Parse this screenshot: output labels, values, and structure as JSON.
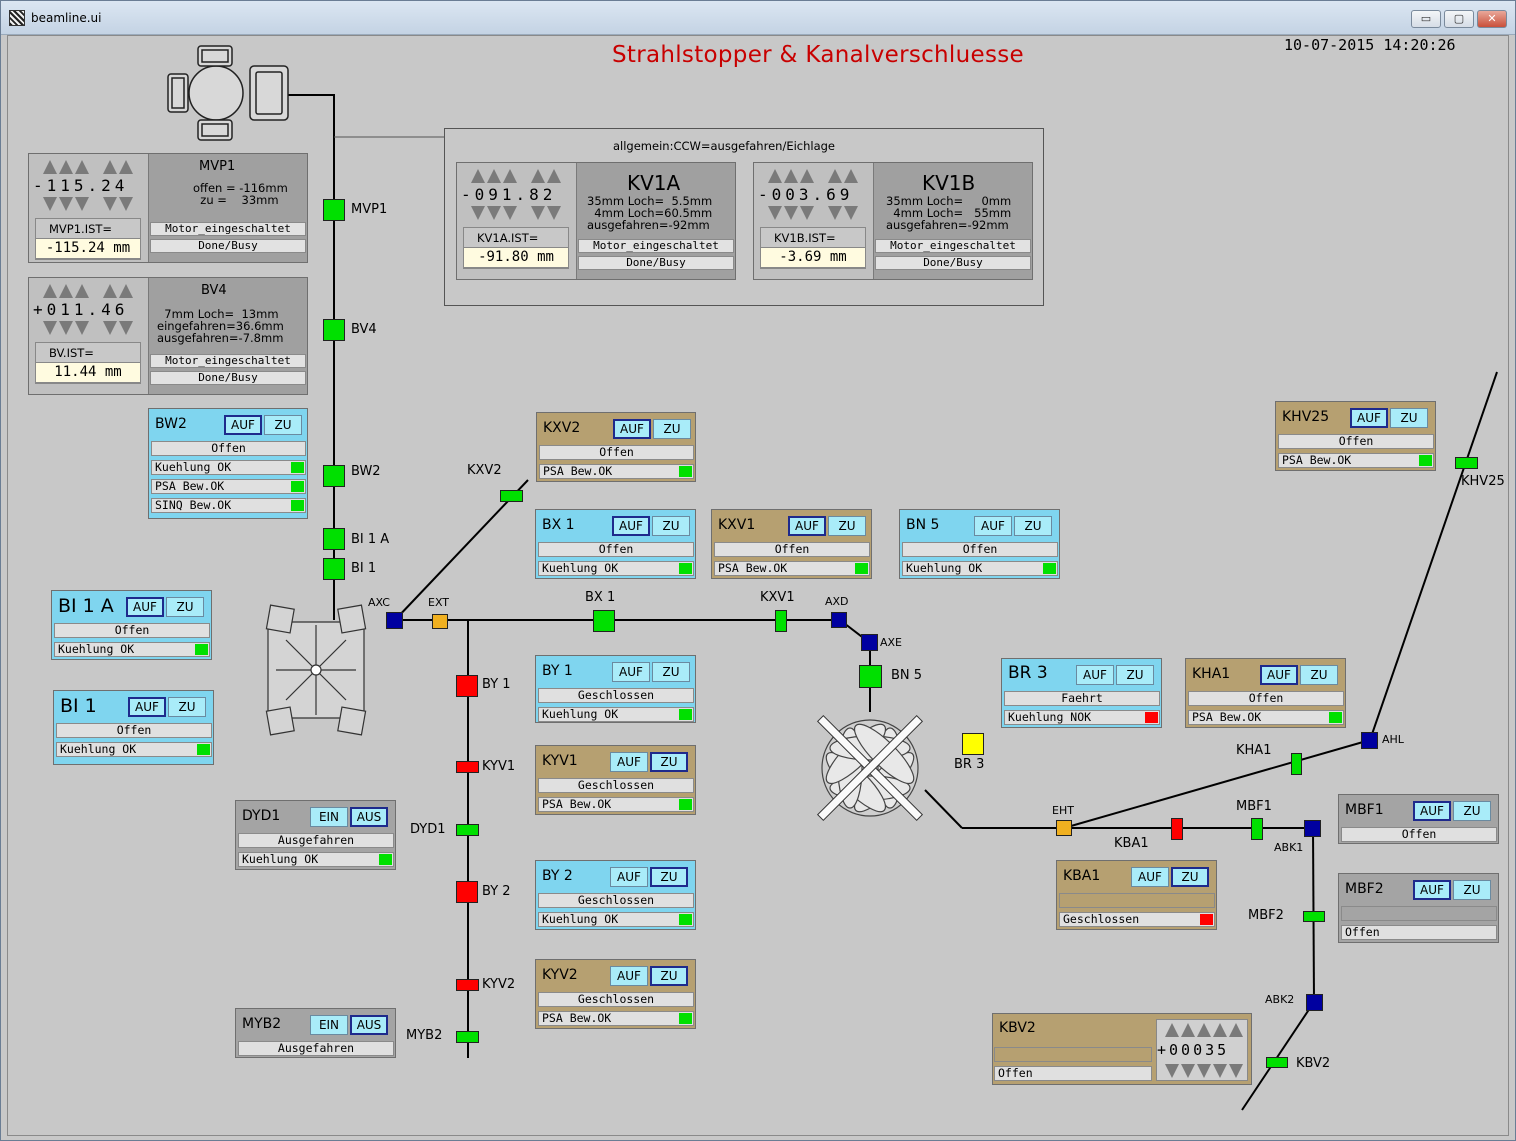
{
  "window": {
    "title": "beamline.ui",
    "btn_min": "▭",
    "btn_max": "▢",
    "btn_close": "✕"
  },
  "page": {
    "title": "Strahlstopper & Kanalverschluesse",
    "clock": "10-07-2015 14:20:26"
  },
  "group_label": "allgemein:CCW=ausgefahren/Eichlage",
  "motors": {
    "MVP1": {
      "name": "MVP1",
      "digits": "-115.24",
      "desc": "offen = -116mm\n  zu =    33mm",
      "ist_label": "MVP1.IST=",
      "ist_value": "-115.24 mm",
      "status1": "Motor_eingeschaltet",
      "status2": "Done/Busy"
    },
    "BV4": {
      "name": "BV4",
      "digits": "+011.46",
      "desc": "  7mm Loch=  13mm\neingefahren=36.6mm\nausgefahren=-7.8mm",
      "ist_label": "BV.IST=",
      "ist_value": "11.44 mm",
      "status1": "Motor_eingeschaltet",
      "status2": "Done/Busy"
    },
    "KV1A": {
      "name": "KV1A",
      "digits": "-091.82",
      "desc": "35mm Loch=  5.5mm\n  4mm Loch=60.5mm\nausgefahren=-92mm",
      "ist_label": "KV1A.IST=",
      "ist_value": "-91.80 mm",
      "status1": "Motor_eingeschaltet",
      "status2": "Done/Busy"
    },
    "KV1B": {
      "name": "KV1B",
      "digits": "-003.69",
      "desc": "35mm Loch=     0mm\n  4mm Loch=   55mm\nausgefahren=-92mm",
      "ist_label": "KV1B.IST=",
      "ist_value": "-3.69 mm",
      "status1": "Motor_eingeschaltet",
      "status2": "Done/Busy"
    }
  },
  "panels": {
    "BW2": {
      "name": "BW2",
      "btn1": "AUF",
      "btn2": "ZU",
      "state": "Offen",
      "rows": [
        "Kuehlung OK",
        "PSA Bew.OK",
        "SINQ Bew.OK"
      ]
    },
    "KXV2": {
      "name": "KXV2",
      "btn1": "AUF",
      "btn2": "ZU",
      "state": "Offen",
      "rows": [
        "PSA Bew.OK"
      ]
    },
    "BX1": {
      "name": "BX 1",
      "btn1": "AUF",
      "btn2": "ZU",
      "state": "Offen",
      "rows": [
        "Kuehlung OK"
      ]
    },
    "KXV1": {
      "name": "KXV1",
      "btn1": "AUF",
      "btn2": "ZU",
      "state": "Offen",
      "rows": [
        "PSA Bew.OK"
      ]
    },
    "BN5": {
      "name": "BN 5",
      "btn1": "AUF",
      "btn2": "ZU",
      "state": "Offen",
      "rows": [
        "Kuehlung OK"
      ]
    },
    "KHV25": {
      "name": "KHV25",
      "btn1": "AUF",
      "btn2": "ZU",
      "state": "Offen",
      "rows": [
        "PSA Bew.OK"
      ]
    },
    "BI1A": {
      "name": "BI 1 A",
      "btn1": "AUF",
      "btn2": "ZU",
      "state": "Offen",
      "rows": [
        "Kuehlung OK"
      ]
    },
    "BI1": {
      "name": "BI 1",
      "btn1": "AUF",
      "btn2": "ZU",
      "state": "Offen",
      "rows": [
        "Kuehlung OK"
      ]
    },
    "BY1": {
      "name": "BY 1",
      "btn1": "AUF",
      "btn2": "ZU",
      "state": "Geschlossen",
      "rows": [
        "Kuehlung OK"
      ]
    },
    "KYV1": {
      "name": "KYV1",
      "btn1": "AUF",
      "btn2": "ZU",
      "state": "Geschlossen",
      "rows": [
        "PSA Bew.OK"
      ]
    },
    "BY2": {
      "name": "BY 2",
      "btn1": "AUF",
      "btn2": "ZU",
      "state": "Geschlossen",
      "rows": [
        "Kuehlung OK"
      ]
    },
    "KYV2": {
      "name": "KYV2",
      "btn1": "AUF",
      "btn2": "ZU",
      "state": "Geschlossen",
      "rows": [
        "PSA Bew.OK"
      ]
    },
    "BR3": {
      "name": "BR 3",
      "btn1": "AUF",
      "btn2": "ZU",
      "state": "Faehrt",
      "rows": [
        "Kuehlung NOK"
      ]
    },
    "KHA1": {
      "name": "KHA1",
      "btn1": "AUF",
      "btn2": "ZU",
      "state": "Offen",
      "rows": [
        "PSA Bew.OK"
      ]
    },
    "MBF1": {
      "name": "MBF1",
      "btn1": "AUF",
      "btn2": "ZU",
      "state": "Offen",
      "rows": []
    },
    "MBF2": {
      "name": "MBF2",
      "btn1": "AUF",
      "btn2": "ZU",
      "state": "",
      "rows": [
        "Offen"
      ]
    },
    "KBA1": {
      "name": "KBA1",
      "btn1": "AUF",
      "btn2": "ZU",
      "state": "",
      "rows": [
        "Geschlossen"
      ]
    },
    "DYD1": {
      "name": "DYD1",
      "btn1": "EIN",
      "btn2": "AUS",
      "state": "Ausgefahren",
      "rows": [
        "Kuehlung OK"
      ]
    },
    "MYB2": {
      "name": "MYB2",
      "btn1": "EIN",
      "btn2": "AUS",
      "state": "Ausgefahren",
      "rows": []
    }
  },
  "kbv2": {
    "name": "KBV2",
    "counter": "+00035",
    "row": "Offen"
  },
  "nodes": {
    "MVP1": "MVP1",
    "BV4": "BV4",
    "BW2": "BW2",
    "BI1A": "BI 1 A",
    "BI1": "BI 1",
    "AXC": "AXC",
    "EXT": "EXT",
    "BX1": "BX 1",
    "KXV1": "KXV1",
    "AXD": "AXD",
    "AXE": "AXE",
    "BN5": "BN 5",
    "KXV2": "KXV2",
    "BY1": "BY 1",
    "KYV1": "KYV1",
    "DYD1": "DYD1",
    "BY2": "BY 2",
    "KYV2": "KYV2",
    "MYB2": "MYB2",
    "BR3": "BR 3",
    "EHT": "EHT",
    "KBA1": "KBA1",
    "MBF1": "MBF1",
    "ABK1": "ABK1",
    "MBF2": "MBF2",
    "ABK2": "ABK2",
    "KBV2": "KBV2",
    "KHA1": "KHA1",
    "AHL": "AHL",
    "KHV25": "KHV25"
  },
  "colors": {
    "ok": "#00e000",
    "error": "#ff0000",
    "warn": "#f0b020",
    "blue": "#0000a0",
    "yellow": "#ffff00"
  }
}
